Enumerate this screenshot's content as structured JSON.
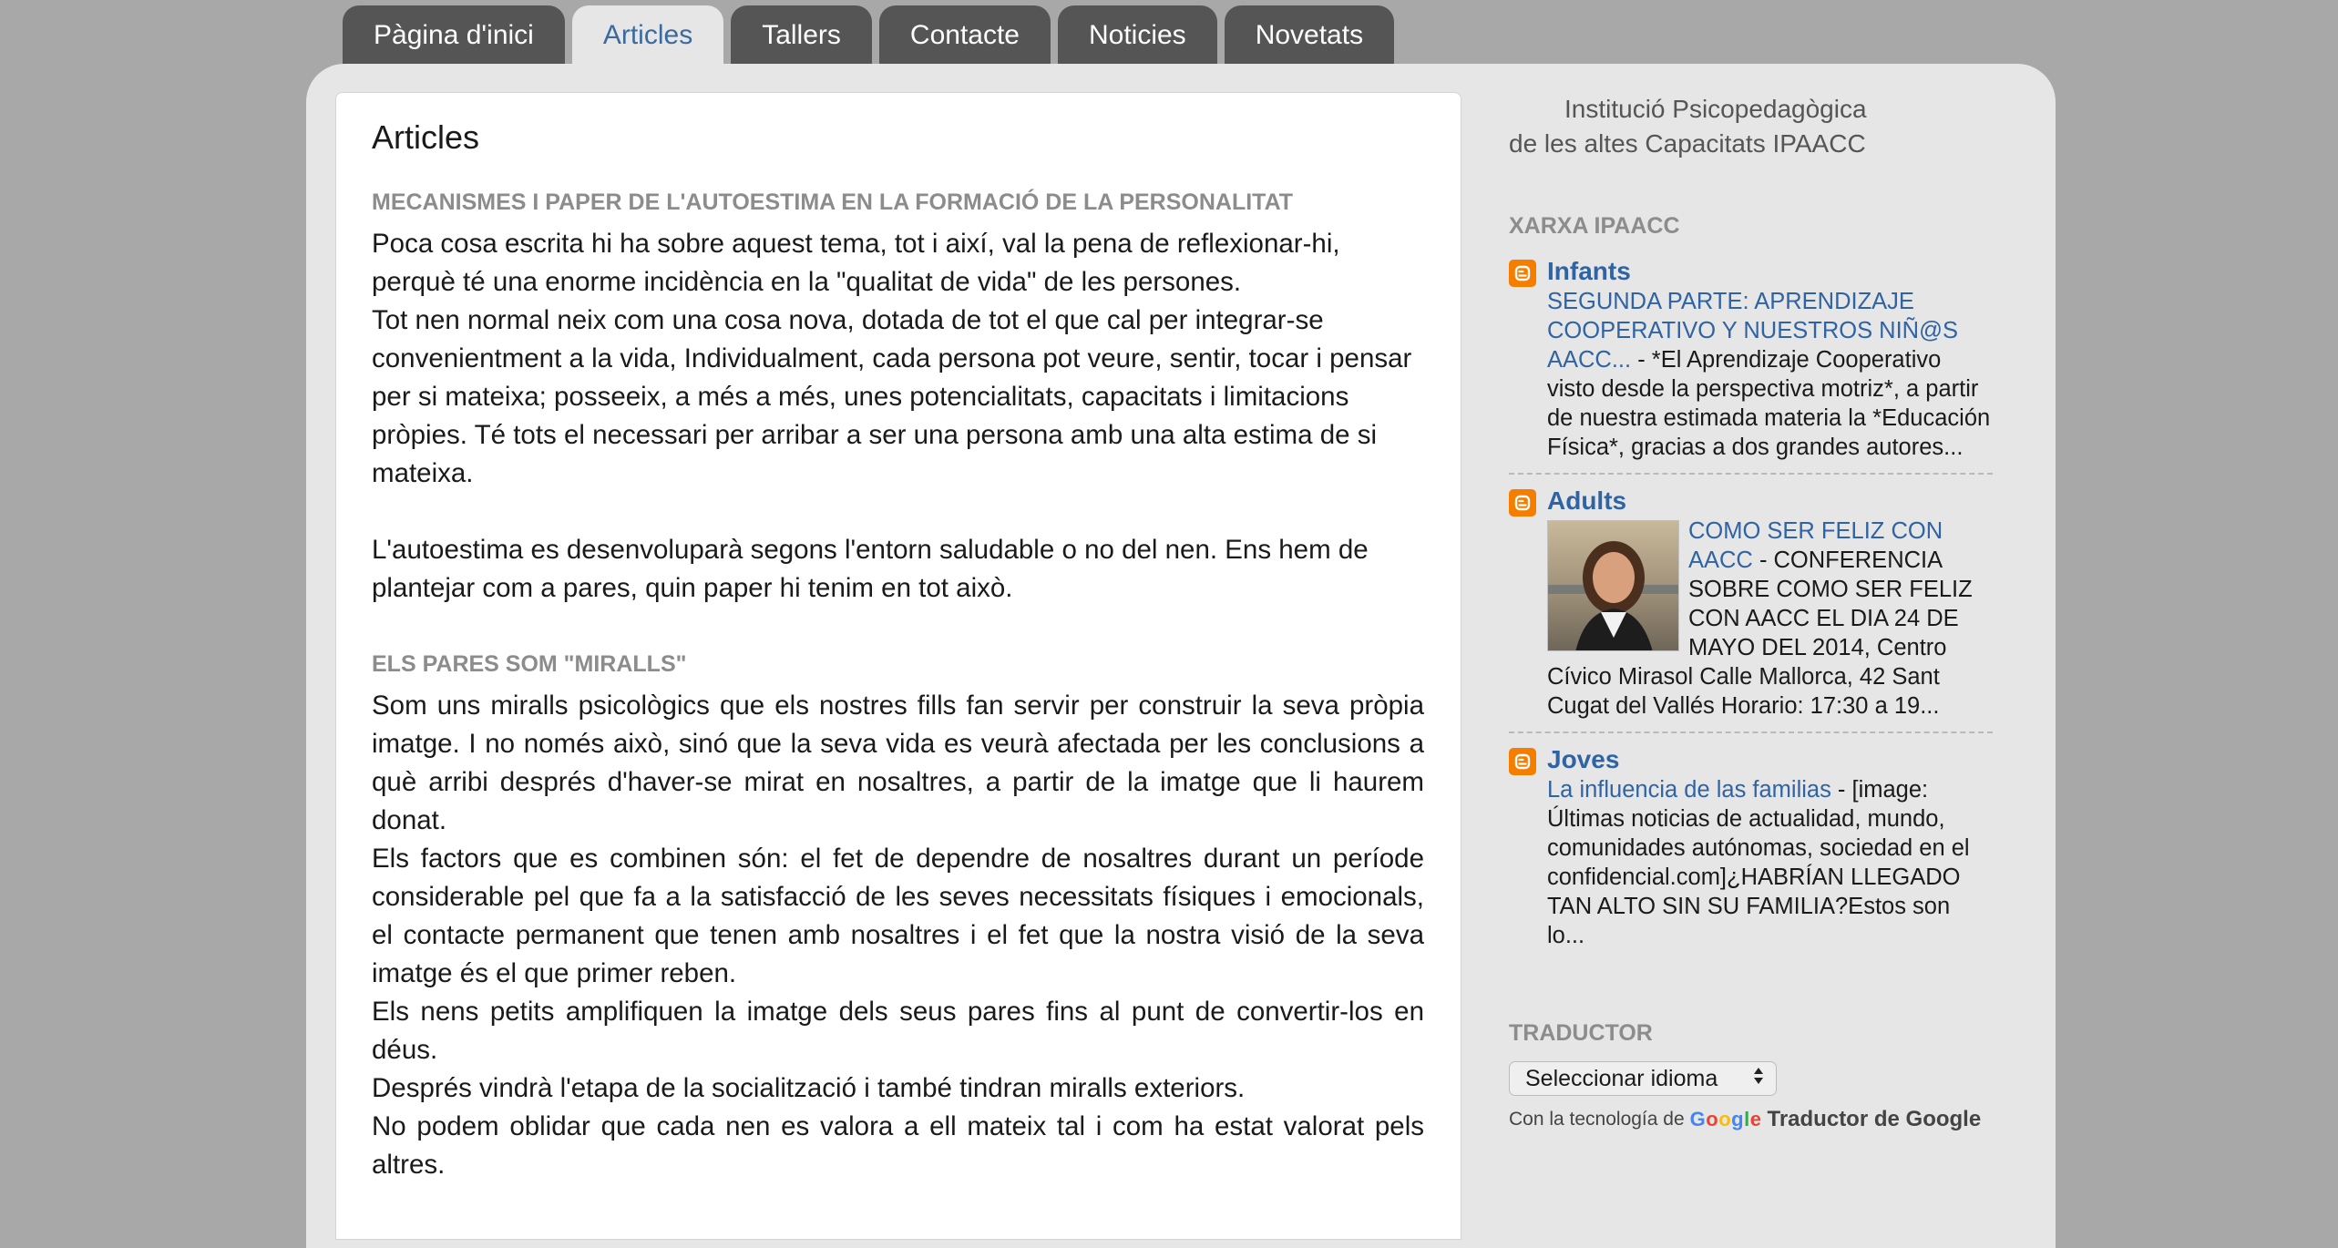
{
  "nav": {
    "tabs": [
      {
        "label": "Pàgina d'inici"
      },
      {
        "label": "Articles"
      },
      {
        "label": "Tallers"
      },
      {
        "label": "Contacte"
      },
      {
        "label": "Noticies"
      },
      {
        "label": "Novetats"
      }
    ],
    "active_index": 1
  },
  "main": {
    "title": "Articles",
    "sections": [
      {
        "heading": "MECANISMES I PAPER DE L'AUTOESTIMA EN LA FORMACIÓ DE LA PERSONALITAT",
        "paragraphs": [
          "Poca cosa escrita hi ha sobre aquest tema, tot i així, val la pena de reflexionar-hi, perquè té una enorme incidència en la \"qualitat de vida\" de les persones.",
          "Tot nen normal neix com una cosa nova, dotada de tot el que cal per integrar-se convenientment a la vida, Individualment, cada persona pot veure, sentir, tocar i pensar per si mateixa; posseeix, a més a més, unes potencialitats, capacitats i limitacions pròpies. Té tots el necessari per arribar a ser una persona amb una alta estima de si mateixa.",
          "L'autoestima es desenvoluparà segons l'entorn saludable o no del nen. Ens hem de plantejar com a pares, quin paper hi tenim en tot això."
        ]
      },
      {
        "heading": "ELS PARES SOM \"MIRALLS\"",
        "paragraphs": [
          "Som uns miralls psicològics que els nostres fills fan servir per construir la seva pròpia imatge. I no només això, sinó que la seva vida es veurà afectada per les conclusions a què arribi després d'haver-se mirat en nosaltres, a partir de la imatge que li haurem donat.",
          "Els factors que es combinen són: el fet de dependre de nosaltres durant un període considerable pel que fa a la satisfacció de les seves necessitats físiques i emocionals, el contacte permanent que tenen amb nosaltres i el fet que la nostra visió de la seva imatge és el que primer reben.",
          "Els nens petits amplifiquen la imatge dels seus pares fins al punt de convertir-los en déus.",
          "Després vindrà l'etapa de la socialització i també tindran miralls exteriors.",
          "No podem oblidar que cada nen es valora a ell mateix tal i com ha estat valorat pels altres."
        ]
      }
    ]
  },
  "sidebar": {
    "institution_line1": "Institució Psicopedagògica",
    "institution_line2": "de les altes Capacitats IPAACC",
    "network": {
      "title": "XARXA IPAACC",
      "blogs": [
        {
          "name": "Infants",
          "post_title": "SEGUNDA PARTE: APRENDIZAJE COOPERATIVO Y NUESTROS NIÑ@S AACC...",
          "snippet": " - *El Aprendizaje Cooperativo visto desde la perspectiva motriz*, a partir de nuestra estimada materia la *Educación Física*, gracias a dos grandes autores...",
          "icon": "blogger-icon"
        },
        {
          "name": "Adults",
          "post_title": "COMO SER FELIZ CON AACC",
          "snippet": " - CONFERENCIA SOBRE COMO SER FELIZ CON AACC EL DIA 24 DE MAYO DEL 2014, Centro Cívico Mirasol Calle Mallorca, 42 Sant Cugat del Vallés Horario: 17:30 a 19...",
          "icon": "blogger-icon"
        },
        {
          "name": "Joves",
          "post_title": "La influencia de las familias",
          "snippet": " - [image: Últimas noticias de actualidad, mundo, comunidades autónomas, sociedad en el confidencial.com]¿HABRÍAN LLEGADO TAN ALTO SIN SU FAMILIA?Estos son lo...",
          "icon": "blogger-icon"
        }
      ]
    },
    "translator": {
      "title": "TRADUCTOR",
      "select_value": "Seleccionar idioma",
      "powered_by": "Con la tecnología de",
      "google": "Google",
      "product": "Traductor de Google"
    }
  },
  "colors": {
    "background": "#a8a8a8",
    "tab": "#555555",
    "active_tab_text": "#3d6a9e",
    "link": "#2f63a3",
    "blogger_orange": "#f57d00"
  }
}
